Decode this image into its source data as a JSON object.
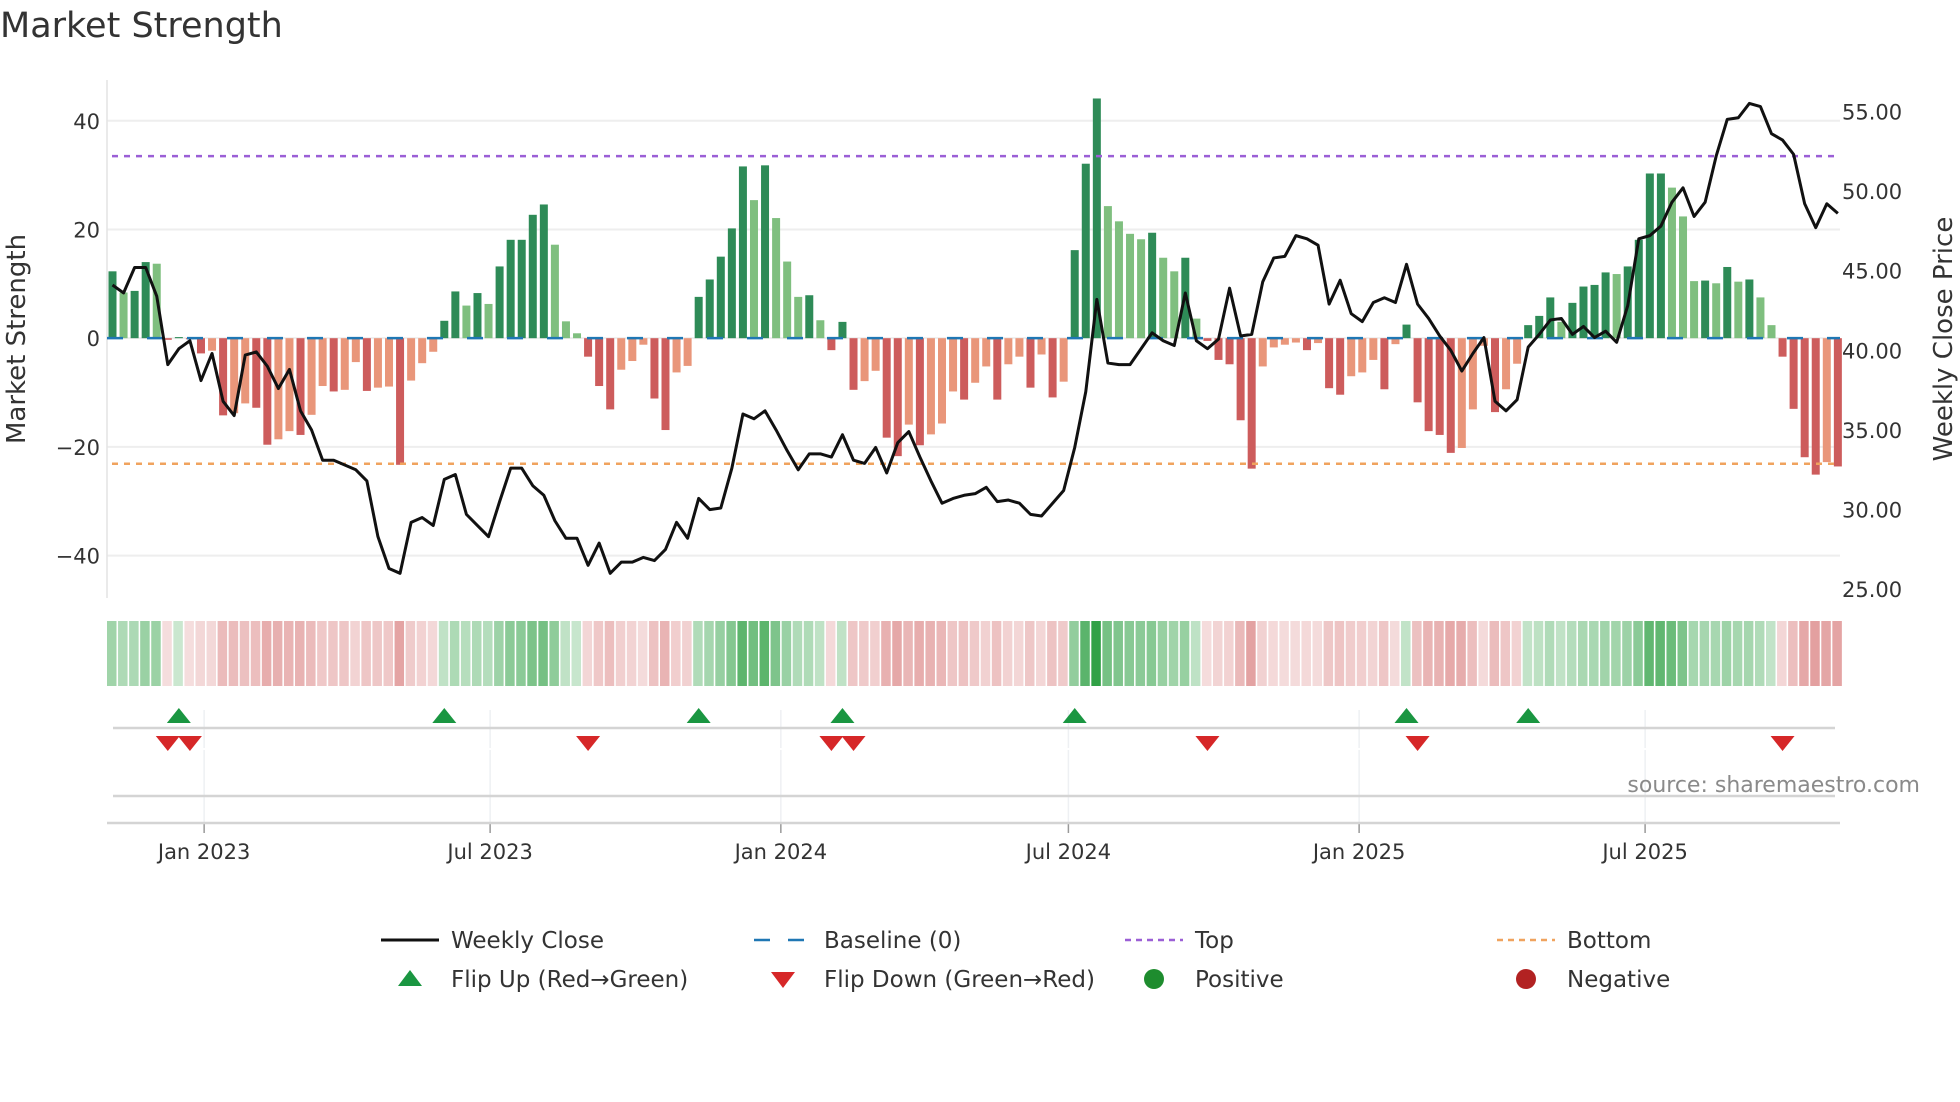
{
  "chart_data": {
    "type": "bar",
    "title": "Market Strength",
    "ylabel": "Market Strength",
    "y2label": "Weekly Close Price",
    "start_week": "2022-11-04",
    "frequency": "weekly",
    "ylim": [
      -47.8,
      47.5
    ],
    "y2lim": [
      24.45,
      56.97
    ],
    "yticks": [
      40,
      20,
      0,
      -20,
      -40
    ],
    "ytick_labels": [
      "40",
      "20",
      "0",
      "−20",
      "−40"
    ],
    "y2ticks": [
      55,
      50,
      45,
      40,
      35,
      30,
      25
    ],
    "y2tick_labels": [
      "55.00",
      "50.00",
      "45.00",
      "40.00",
      "35.00",
      "30.00",
      "25.00"
    ],
    "xticks": [
      "2023-01-01",
      "2023-07-01",
      "2024-01-01",
      "2024-07-01",
      "2025-01-01",
      "2025-07-01"
    ],
    "xtick_labels": [
      "Jan 2023",
      "Jul 2023",
      "Jan 2024",
      "Jul 2024",
      "Jan 2025",
      "Jul 2025"
    ],
    "top_threshold": 33.5,
    "bottom_threshold": -23.1,
    "baseline": 0,
    "grid": true,
    "legend_position": "bottom",
    "series": [
      {
        "name": "Market Strength",
        "type": "bar",
        "values": [
          12.3,
          8.4,
          8.7,
          14,
          13.7,
          -0.3,
          0.2,
          -0.2,
          -2.8,
          -2.3,
          -14.2,
          -13.8,
          -12,
          -12.8,
          -19.6,
          -18.6,
          -17.1,
          -17.8,
          -14.1,
          -8.8,
          -9.8,
          -9.5,
          -4.4,
          -9.7,
          -9.1,
          -8.9,
          -23.3,
          -7.8,
          -4.6,
          -2.5,
          3.2,
          8.6,
          6,
          8.3,
          6.3,
          13.2,
          18.1,
          18.1,
          22.7,
          24.6,
          17.2,
          3.1,
          0.9,
          -3.4,
          -8.8,
          -13.1,
          -5.8,
          -4.2,
          -1.2,
          -11.1,
          -16.9,
          -6.3,
          -5.1,
          7.6,
          10.8,
          15,
          20.2,
          31.6,
          25.4,
          31.8,
          22.1,
          14.1,
          7.6,
          7.9,
          3.3,
          -2.2,
          3,
          -9.5,
          -7.9,
          -6,
          -18.3,
          -21.7,
          -15.9,
          -19.7,
          -17.7,
          -15.7,
          -9.8,
          -11.3,
          -8.2,
          -5.2,
          -11.3,
          -4.8,
          -3.4,
          -9.1,
          -3,
          -10.9,
          -8,
          16.2,
          32.1,
          44.1,
          24.3,
          21.5,
          19.2,
          18.2,
          19.4,
          14.8,
          12.3,
          14.8,
          3.6,
          -0.5,
          -4,
          -4.8,
          -15.1,
          -24,
          -5.2,
          -1.7,
          -1.2,
          -0.8,
          -2.2,
          -0.9,
          -9.2,
          -10.4,
          -7,
          -6.3,
          -4,
          -9.4,
          -1.1,
          2.5,
          -11.8,
          -17.1,
          -17.8,
          -21.1,
          -20.2,
          -13.1,
          -1.4,
          -13.6,
          -9.4,
          -4.7,
          2.4,
          4.1,
          7.5,
          3,
          6.5,
          9.5,
          9.8,
          12.1,
          11.8,
          13.2,
          18.1,
          30.3,
          30.3,
          27.7,
          22.4,
          10.5,
          10.6,
          10.1,
          13.1,
          10.4,
          10.8,
          7.5,
          2.4,
          -3.4,
          -13,
          -21.9,
          -25.1,
          -22.8,
          -23.6
        ]
      },
      {
        "name": "Weekly Close",
        "type": "line",
        "axis": "right",
        "values": [
          44.1,
          43.6,
          45.2,
          45.2,
          43.4,
          39.1,
          40.1,
          40.6,
          38.1,
          39.8,
          36.8,
          35.9,
          39.7,
          39.9,
          39.0,
          37.6,
          38.8,
          36.2,
          35.0,
          33.1,
          33.1,
          32.8,
          32.5,
          31.8,
          28.3,
          26.3,
          26.0,
          29.2,
          29.5,
          29.0,
          31.9,
          32.2,
          29.7,
          29.0,
          28.3,
          30.5,
          32.6,
          32.6,
          31.5,
          30.9,
          29.3,
          28.2,
          28.2,
          26.5,
          27.9,
          26.0,
          26.7,
          26.7,
          27.0,
          26.8,
          27.5,
          29.2,
          28.2,
          30.7,
          30.0,
          30.1,
          32.6,
          36.0,
          35.7,
          36.2,
          35.0,
          33.7,
          32.5,
          33.5,
          33.5,
          33.3,
          34.7,
          33.1,
          32.9,
          33.9,
          32.3,
          34.2,
          34.9,
          33.3,
          31.8,
          30.4,
          30.7,
          30.9,
          31.0,
          31.4,
          30.5,
          30.6,
          30.4,
          29.7,
          29.6,
          30.4,
          31.2,
          33.9,
          37.4,
          43.2,
          39.2,
          39.1,
          39.1,
          40.1,
          41.1,
          40.6,
          40.3,
          43.6,
          40.6,
          40.1,
          40.7,
          43.9,
          40.9,
          41.0,
          44.3,
          45.8,
          45.9,
          47.2,
          47.0,
          46.6,
          42.9,
          44.4,
          42.3,
          41.8,
          43.0,
          43.3,
          43.0,
          45.4,
          42.9,
          42.0,
          40.9,
          40.0,
          38.7,
          39.8,
          40.8,
          36.8,
          36.2,
          36.9,
          40.2,
          41.0,
          41.9,
          42.0,
          41.0,
          41.5,
          40.8,
          41.2,
          40.5,
          42.8,
          47.0,
          47.2,
          47.8,
          49.3,
          50.2,
          48.4,
          49.3,
          52.2,
          54.5,
          54.6,
          55.5,
          55.3,
          53.6,
          53.2,
          52.3,
          49.2,
          47.7,
          49.2,
          48.6
        ]
      }
    ],
    "legend": [
      {
        "label": "Weekly Close",
        "marker": "line",
        "color": "#111111"
      },
      {
        "label": "Baseline (0)",
        "marker": "dash",
        "color": "#1f77b4"
      },
      {
        "label": "Top",
        "marker": "dot",
        "color": "#9b5fd6"
      },
      {
        "label": "Bottom",
        "marker": "dot",
        "color": "#f0a35e"
      },
      {
        "label": "Flip Up (Red→Green)",
        "marker": "triangle-up",
        "color": "#1a9641"
      },
      {
        "label": "Flip Down (Green→Red)",
        "marker": "triangle-down",
        "color": "#d62728"
      },
      {
        "label": "Positive",
        "marker": "circle",
        "color": "#1e8c2e"
      },
      {
        "label": "Negative",
        "marker": "circle",
        "color": "#b22222"
      }
    ],
    "colors": {
      "pos_strong": "#2e8b57",
      "pos_weak": "#7fbf7f",
      "neg_strong": "#cd5c5c",
      "neg_weak": "#e9967a",
      "grid": "#eeeeee",
      "axis": "#cccccc"
    },
    "source": "source: sharemaestro.com"
  }
}
